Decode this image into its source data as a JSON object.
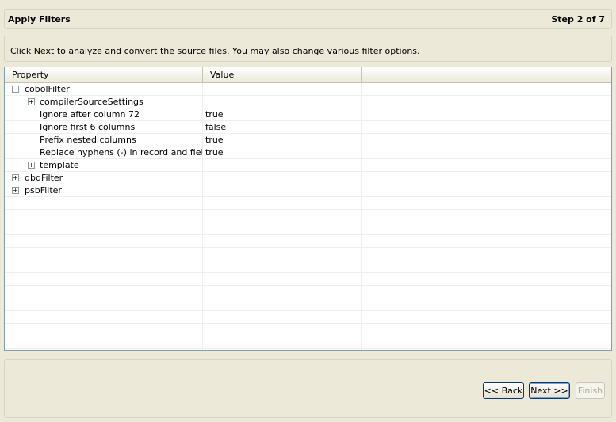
{
  "header": {
    "title": "Apply Filters",
    "step": "Step 2 of 7"
  },
  "description": "Click Next to analyze and convert the source files. You may also change various filter options.",
  "table": {
    "columns": [
      "Property",
      "Value"
    ],
    "rows": [
      {
        "property": "cobolFilter",
        "value": "",
        "toggle": "−"
      },
      {
        "property": "compilerSourceSettings",
        "value": "",
        "toggle": "+"
      },
      {
        "property": "Ignore after column 72",
        "value": "true",
        "toggle": ""
      },
      {
        "property": "Ignore first 6 columns",
        "value": "false",
        "toggle": ""
      },
      {
        "property": "Prefix nested columns",
        "value": "true",
        "toggle": ""
      },
      {
        "property": "Replace hyphens (-) in record and field names",
        "value": "true",
        "toggle": ""
      },
      {
        "property": "template",
        "value": "",
        "toggle": "+"
      },
      {
        "property": "dbdFilter",
        "value": "",
        "toggle": "+"
      },
      {
        "property": "psbFilter",
        "value": "",
        "toggle": "+"
      }
    ]
  },
  "buttons": {
    "back": "<< Back",
    "next": "Next >>",
    "finish": "Finish"
  }
}
